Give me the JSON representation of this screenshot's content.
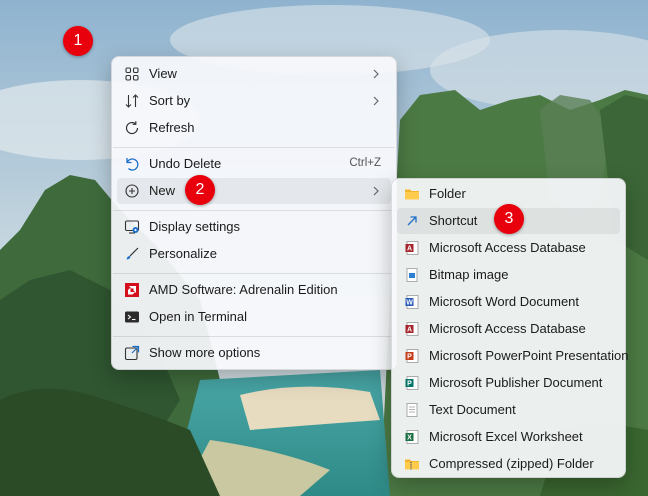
{
  "main_menu": {
    "items": [
      {
        "label": "View",
        "icon": "grid-icon",
        "submenu": true
      },
      {
        "label": "Sort by",
        "icon": "sort-icon",
        "submenu": true
      },
      {
        "label": "Refresh",
        "icon": "refresh-icon"
      },
      {
        "label": "Undo Delete",
        "icon": "undo-icon",
        "shortcut": "Ctrl+Z"
      },
      {
        "label": "New",
        "icon": "plus-circle-icon",
        "submenu": true
      },
      {
        "label": "Display settings",
        "icon": "display-settings-icon"
      },
      {
        "label": "Personalize",
        "icon": "brush-icon"
      },
      {
        "label": "AMD Software: Adrenalin Edition",
        "icon": "amd-icon"
      },
      {
        "label": "Open in Terminal",
        "icon": "terminal-icon"
      },
      {
        "label": "Show more options",
        "icon": "expand-icon"
      }
    ]
  },
  "new_submenu": {
    "items": [
      {
        "label": "Folder",
        "icon": "folder-icon"
      },
      {
        "label": "Shortcut",
        "icon": "shortcut-icon"
      },
      {
        "label": "Microsoft Access Database",
        "icon": "access-icon"
      },
      {
        "label": "Bitmap image",
        "icon": "bitmap-icon"
      },
      {
        "label": "Microsoft Word Document",
        "icon": "word-icon"
      },
      {
        "label": "Microsoft Access Database",
        "icon": "access-icon"
      },
      {
        "label": "Microsoft PowerPoint Presentation",
        "icon": "powerpoint-icon"
      },
      {
        "label": "Microsoft Publisher Document",
        "icon": "publisher-icon"
      },
      {
        "label": "Text Document",
        "icon": "text-document-icon"
      },
      {
        "label": "Microsoft Excel Worksheet",
        "icon": "excel-icon"
      },
      {
        "label": "Compressed (zipped) Folder",
        "icon": "zip-folder-icon"
      }
    ]
  },
  "badges": [
    "1",
    "2",
    "3"
  ],
  "colors": {
    "badge": "#e8000c",
    "menu_bg": "#f7f9fc",
    "highlight": "#e9ecf0"
  }
}
